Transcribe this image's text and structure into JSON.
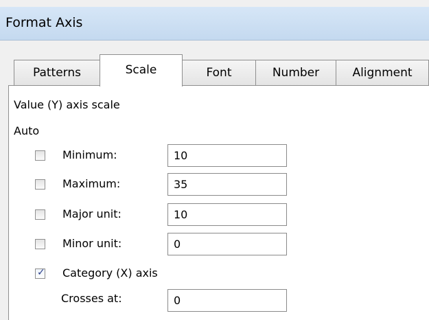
{
  "window": {
    "title": "Format Axis"
  },
  "tabs": [
    {
      "label": "Patterns",
      "active": false
    },
    {
      "label": "Scale",
      "active": true
    },
    {
      "label": "Font",
      "active": false
    },
    {
      "label": "Number",
      "active": false
    },
    {
      "label": "Alignment",
      "active": false
    }
  ],
  "scale": {
    "heading": "Value (Y) axis scale",
    "auto_label": "Auto",
    "minimum": {
      "label": "Minimum:",
      "checked": false,
      "value": "10"
    },
    "maximum": {
      "label": "Maximum:",
      "checked": false,
      "value": "35"
    },
    "major_unit": {
      "label": "Major unit:",
      "checked": false,
      "value": "10"
    },
    "minor_unit": {
      "label": "Minor unit:",
      "checked": false,
      "value": "0"
    },
    "category_axis": {
      "label": "Category (X) axis",
      "checked": true
    },
    "crosses_at": {
      "label": "Crosses at:",
      "value": "0"
    }
  },
  "colors": {
    "title_bar": "#c4d9ef",
    "dialog_bg": "#f0f0f0",
    "check_mark": "#2b3f8a"
  }
}
